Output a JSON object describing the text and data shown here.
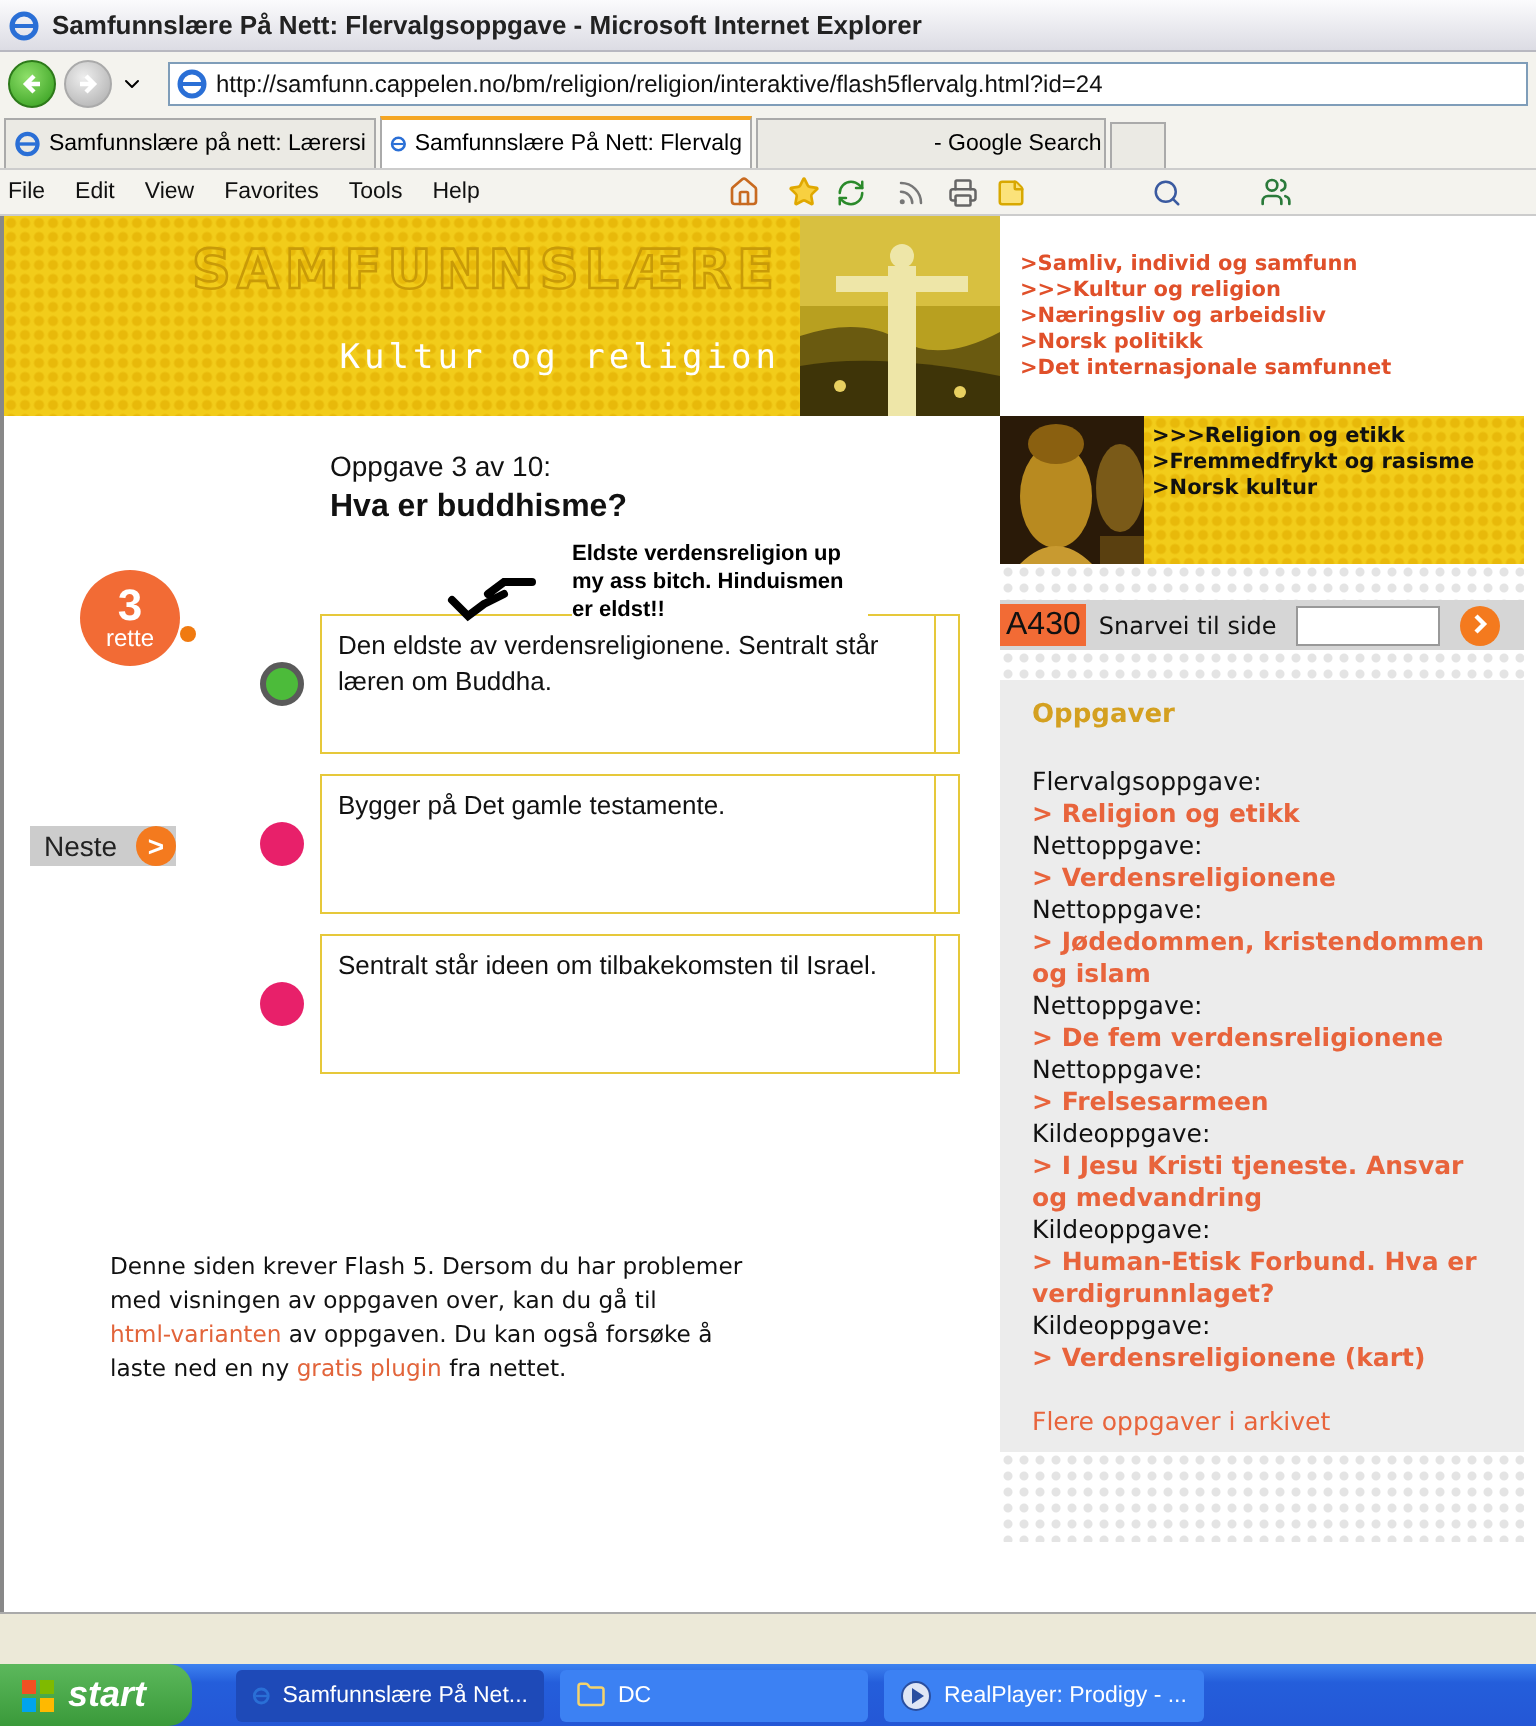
{
  "window": {
    "title": "Samfunnslære På Nett: Flervalgsoppgave - Microsoft Internet Explorer"
  },
  "address_bar": {
    "value": "http://samfunn.cappelen.no/bm/religion/religion/interaktive/flash5flervalg.html?id=24"
  },
  "tabs": [
    {
      "label": "Samfunnslære på nett: Lærersi",
      "selected": false,
      "kind": "ie"
    },
    {
      "label": "Samfunnslære På Nett: Flervalg",
      "selected": true,
      "kind": "ie"
    },
    {
      "label": "- Google Search",
      "selected": false,
      "kind": "google"
    }
  ],
  "menu": [
    "File",
    "Edit",
    "View",
    "Favorites",
    "Tools",
    "Help"
  ],
  "banner": {
    "logo": "SAMFUNNSLÆRE",
    "subtitle": "Kultur og religion"
  },
  "section_links": [
    ">Samliv, individ og samfunn",
    ">>>Kultur og religion",
    ">Næringsliv og arbeidsliv",
    ">Norsk politikk",
    ">Det internasjonale samfunnet"
  ],
  "topic_links": [
    ">>>Religion og etikk",
    ">Fremmedfrykt og rasisme",
    ">Norsk kultur"
  ],
  "quiz": {
    "heading": "Oppgave 3 av 10:",
    "question": "Hva er buddhisme?",
    "score": {
      "value": "3",
      "label": "rette"
    },
    "next_button": ">",
    "next_label": "Neste",
    "answers": [
      {
        "text": "Den eldste av verdensreligionene. Sentralt står læren om Buddha.",
        "color": "#4cbb3a",
        "selected": true
      },
      {
        "text": "Bygger på Det gamle testamente.",
        "color": "#e8206a",
        "selected": false
      },
      {
        "text": "Sentralt står ideen om tilbakekomsten til Israel.",
        "color": "#e8206a",
        "selected": false
      }
    ]
  },
  "annotation": "Eldste verdensreligion up my ass bitch. Hinduismen er eldst!!",
  "flash_notice": [
    {
      "text": "Denne siden krever Flash 5. Dersom du har problemer med visningen av oppgaven over, kan du gå til "
    },
    {
      "link": "html-varianten"
    },
    {
      "text": " av oppgaven. Du kan også forsøke å laste ned en ny "
    },
    {
      "link": "gratis plugin"
    },
    {
      "text": " fra nettet."
    }
  ],
  "shortcut": {
    "code": "A430",
    "label": "Snarvei til side"
  },
  "tasks_panel": {
    "title": "Oppgaver",
    "items": [
      {
        "type": "Flervalgsoppgave:",
        "link": "> Religion og etikk"
      },
      {
        "type": "Nettoppgave:",
        "link": "> Verdensreligionene"
      },
      {
        "type": "Nettoppgave:",
        "link": "> Jødedommen, kristendommen og islam"
      },
      {
        "type": "Nettoppgave:",
        "link": "> De fem verdensreligionene"
      },
      {
        "type": "Nettoppgave:",
        "link": "> Frelsesarmeen"
      },
      {
        "type": "Kildeoppgave:",
        "link": "> I Jesu Kristi tjeneste. Ansvar og medvandring"
      },
      {
        "type": "Kildeoppgave:",
        "link": "> Human-Etisk Forbund. Hva er verdigrunnlaget?"
      },
      {
        "type": "Kildeoppgave:",
        "link": "> Verdensreligionene (kart)"
      }
    ],
    "more_link": "Flere oppgaver i arkivet"
  },
  "taskbar": {
    "start": "start",
    "tasks": [
      {
        "label": "Samfunnslære På Net...",
        "selected": true,
        "kind": "ie"
      },
      {
        "label": "DC",
        "selected": false,
        "kind": "folder"
      },
      {
        "label": "RealPlayer: Prodigy - ...",
        "selected": false,
        "kind": "realplayer"
      }
    ]
  }
}
